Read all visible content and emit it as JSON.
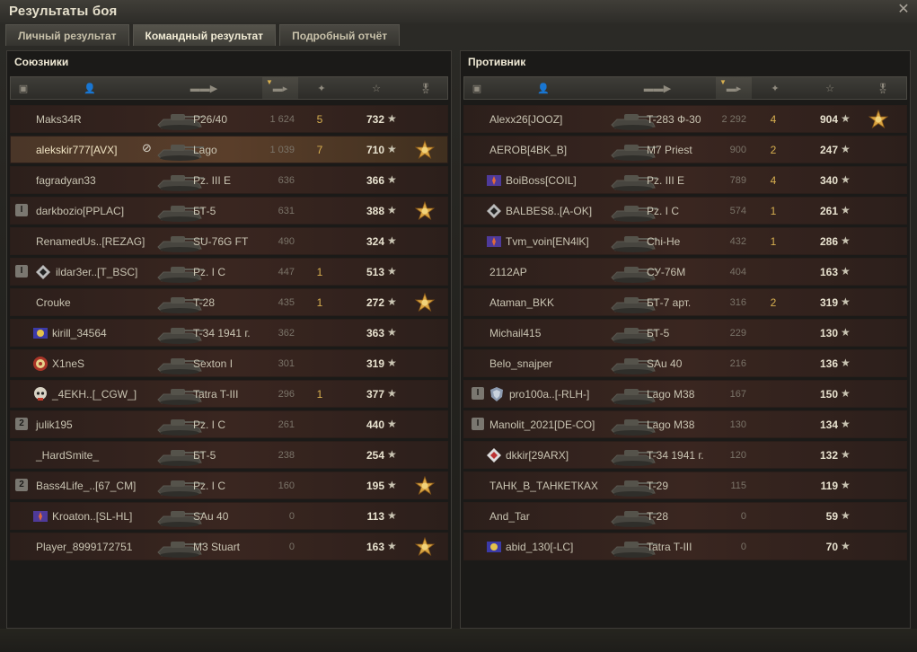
{
  "window": {
    "title": "Результаты боя"
  },
  "tabs": [
    "Личный результат",
    "Командный результат",
    "Подробный отчёт"
  ],
  "active_tab": 1,
  "allies": {
    "title": "Союзники",
    "rows": [
      {
        "name": "Maks34R",
        "tank": "P26/40",
        "dmg": "1 624",
        "kills": "5",
        "xp": "732",
        "medal": false,
        "rank": "",
        "clan": ""
      },
      {
        "name": "alekskir777[AVX]",
        "tank": "Lago",
        "dmg": "1 039",
        "kills": "7",
        "xp": "710",
        "medal": true,
        "medal_badge": "2",
        "rank": "",
        "clan": "",
        "highlight": true,
        "eye": true
      },
      {
        "name": "fagradyan33",
        "tank": "Pz. III E",
        "dmg": "636",
        "kills": "",
        "xp": "366",
        "medal": false,
        "rank": "",
        "clan": ""
      },
      {
        "name": "darkbozio[PPLAC]",
        "tank": "БТ-5",
        "dmg": "631",
        "kills": "",
        "xp": "388",
        "medal": true,
        "rank": "I",
        "clan": ""
      },
      {
        "name": "RenamedUs..[REZAG]",
        "tank": "SU-76G FT",
        "dmg": "490",
        "kills": "",
        "xp": "324",
        "medal": false,
        "rank": "",
        "clan": ""
      },
      {
        "name": "ildar3er..[T_BSC]",
        "tank": "Pz. I C",
        "dmg": "447",
        "kills": "1",
        "xp": "513",
        "medal": false,
        "rank": "I",
        "clan": "diamond"
      },
      {
        "name": "Crouke",
        "tank": "T-28",
        "dmg": "435",
        "kills": "1",
        "xp": "272",
        "medal": true,
        "rank": "",
        "clan": ""
      },
      {
        "name": "kirill_34564",
        "tank": "T-34 1941 г.",
        "dmg": "362",
        "kills": "",
        "xp": "363",
        "medal": false,
        "rank": "",
        "clan": "flag-yellow"
      },
      {
        "name": "X1neS",
        "tank": "Sexton I",
        "dmg": "301",
        "kills": "",
        "xp": "319",
        "medal": false,
        "rank": "",
        "clan": "target"
      },
      {
        "name": "_4EKH..[_CGW_]",
        "tank": "Tatra T-III",
        "dmg": "296",
        "kills": "1",
        "xp": "377",
        "medal": false,
        "rank": "",
        "clan": "skull"
      },
      {
        "name": "julik195",
        "tank": "Pz. I C",
        "dmg": "261",
        "kills": "",
        "xp": "440",
        "medal": false,
        "rank": "2",
        "clan": ""
      },
      {
        "name": "_HardSmite_",
        "tank": "БТ-5",
        "dmg": "238",
        "kills": "",
        "xp": "254",
        "medal": false,
        "rank": "",
        "clan": ""
      },
      {
        "name": "Bass4Life_..[67_CM]",
        "tank": "Pz. I C",
        "dmg": "160",
        "kills": "",
        "xp": "195",
        "medal": true,
        "rank": "2",
        "clan": ""
      },
      {
        "name": "Kroaton..[SL-HL]",
        "tank": "SAu 40",
        "dmg": "0",
        "kills": "",
        "xp": "113",
        "medal": false,
        "rank": "",
        "clan": "flag-purple"
      },
      {
        "name": "Player_8999172751",
        "tank": "M3 Stuart",
        "dmg": "0",
        "kills": "",
        "xp": "163",
        "medal": true,
        "rank": "",
        "clan": ""
      }
    ]
  },
  "enemies": {
    "title": "Противник",
    "rows": [
      {
        "name": "Alexx26[JOOZ]",
        "tank": "T-283 Ф-30",
        "dmg": "2 292",
        "kills": "4",
        "xp": "904",
        "medal": true,
        "rank": "",
        "clan": ""
      },
      {
        "name": "AEROB[4BK_B]",
        "tank": "M7 Priest",
        "dmg": "900",
        "kills": "2",
        "xp": "247",
        "medal": false,
        "rank": "",
        "clan": ""
      },
      {
        "name": "BoiBoss[COIL]",
        "tank": "Pz. III E",
        "dmg": "789",
        "kills": "4",
        "xp": "340",
        "medal": false,
        "rank": "",
        "clan": "flag-purple"
      },
      {
        "name": "BALBES8..[A-OK]",
        "tank": "Pz. I C",
        "dmg": "574",
        "kills": "1",
        "xp": "261",
        "medal": false,
        "rank": "",
        "clan": "diamond"
      },
      {
        "name": "Tvm_voin[EN4lK]",
        "tank": "Chi-He",
        "dmg": "432",
        "kills": "1",
        "xp": "286",
        "medal": false,
        "rank": "",
        "clan": "flag-purple"
      },
      {
        "name": "2112AP",
        "tank": "СУ-76М",
        "dmg": "404",
        "kills": "",
        "xp": "163",
        "medal": false,
        "rank": "",
        "clan": ""
      },
      {
        "name": "Ataman_BKK",
        "tank": "БТ-7 арт.",
        "dmg": "316",
        "kills": "2",
        "xp": "319",
        "medal": false,
        "rank": "",
        "clan": ""
      },
      {
        "name": "Michail415",
        "tank": "БТ-5",
        "dmg": "229",
        "kills": "",
        "xp": "130",
        "medal": false,
        "rank": "",
        "clan": ""
      },
      {
        "name": "Belo_snajper",
        "tank": "SAu 40",
        "dmg": "216",
        "kills": "",
        "xp": "136",
        "medal": false,
        "rank": "",
        "clan": ""
      },
      {
        "name": "pro100a..[-RLH-]",
        "tank": "Lago M38",
        "dmg": "167",
        "kills": "",
        "xp": "150",
        "medal": false,
        "rank": "I",
        "clan": "shield"
      },
      {
        "name": "Manolit_2021[DE-CO]",
        "tank": "Lago M38",
        "dmg": "130",
        "kills": "",
        "xp": "134",
        "medal": false,
        "rank": "I",
        "clan": ""
      },
      {
        "name": "dkkir[29ARX]",
        "tank": "T-34 1941 г.",
        "dmg": "120",
        "kills": "",
        "xp": "132",
        "medal": false,
        "rank": "",
        "clan": "diamond-red"
      },
      {
        "name": "ТАНК_В_ТАНКЕТКАХ",
        "tank": "T-29",
        "dmg": "115",
        "kills": "",
        "xp": "119",
        "medal": false,
        "rank": "",
        "clan": ""
      },
      {
        "name": "And_Tar",
        "tank": "T-28",
        "dmg": "0",
        "kills": "",
        "xp": "59",
        "medal": false,
        "rank": "",
        "clan": ""
      },
      {
        "name": "abid_130[-LC]",
        "tank": "Tatra T-III",
        "dmg": "0",
        "kills": "",
        "xp": "70",
        "medal": false,
        "rank": "",
        "clan": "flag-yellow"
      }
    ]
  },
  "icons": {
    "close": "close-icon",
    "header_clan": "badge-icon",
    "header_player": "player-icon",
    "header_tank": "tank-icon",
    "header_damage": "damage-icon",
    "header_kills": "kills-icon",
    "header_xp": "star-icon",
    "header_medal": "medal-icon"
  }
}
